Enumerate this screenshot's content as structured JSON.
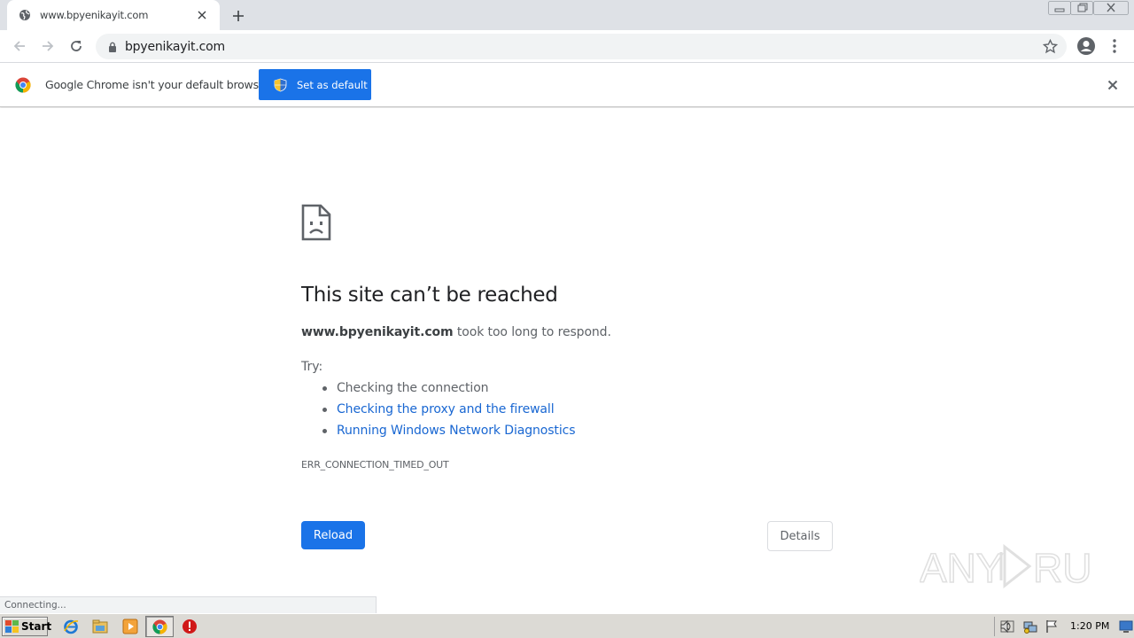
{
  "browser": {
    "tab_title": "www.bpyenikayit.com",
    "url": "bpyenikayit.com"
  },
  "infobar": {
    "message": "Google Chrome isn't your default browser",
    "button_label": "Set as default"
  },
  "error": {
    "title": "This site can’t be reached",
    "host": "www.bpyenikayit.com",
    "description": " took too long to respond.",
    "try_label": "Try:",
    "suggestions": [
      "Checking the connection",
      "Checking the proxy and the firewall",
      "Running Windows Network Diagnostics"
    ],
    "code": "ERR_CONNECTION_TIMED_OUT",
    "reload_label": "Reload",
    "details_label": "Details"
  },
  "status": {
    "text": "Connecting..."
  },
  "taskbar": {
    "start_label": "Start",
    "clock": "1:20 PM"
  },
  "colors": {
    "accent": "#1a73e8",
    "link": "#1967d2"
  }
}
